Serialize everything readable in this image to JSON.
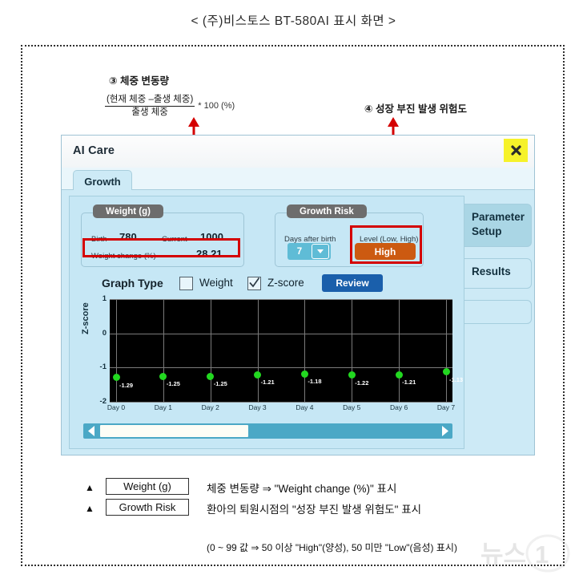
{
  "figure_caption": "< (주)비스토스 BT-580AI 표시 화면 >",
  "annotations": [
    {
      "id": "annotation-weight-change",
      "title": "③ 체중 변동량",
      "formula_numerator": "(현재 체중 –출생 체중)",
      "formula_denominator": "출생 체중",
      "formula_tail": "* 100 (%)"
    },
    {
      "id": "annotation-growth-risk",
      "title": "④ 성장 부진 발생 위험도"
    }
  ],
  "app": {
    "title": "AI Care",
    "close_icon": "close-x-icon",
    "tabs": [
      {
        "label": "Growth",
        "selected": true
      }
    ],
    "side_tabs": [
      {
        "label": "Parameter Setup",
        "selected": true
      },
      {
        "label": "Results",
        "selected": false
      }
    ],
    "weight_group": {
      "legend": "Weight (g)",
      "birth_label": "Birth",
      "birth_value": "780",
      "current_label": "Current",
      "current_value": "1000",
      "change_label": "Weight change (%)",
      "change_value": "28.21"
    },
    "risk_group": {
      "legend": "Growth Risk",
      "days_label": "Days after birth",
      "days_value": "7",
      "dropdown_icon": "chevron-down-icon",
      "level_label": "Level (Low, High)",
      "level_value": "High"
    },
    "graph_type": {
      "label": "Graph Type",
      "options": [
        {
          "label": "Weight",
          "checked": false
        },
        {
          "label": "Z-score",
          "checked": true
        }
      ],
      "review_label": "Review"
    },
    "scrollbar": {
      "left_icon": "triangle-left-icon",
      "right_icon": "triangle-right-icon"
    }
  },
  "chart_data": {
    "type": "scatter",
    "title": "",
    "xlabel": "",
    "ylabel": "Z-score",
    "categories": [
      "Day 0",
      "Day 1",
      "Day 2",
      "Day 3",
      "Day 4",
      "Day 5",
      "Day 6",
      "Day 7"
    ],
    "values": [
      -1.29,
      -1.25,
      -1.25,
      -1.21,
      -1.18,
      -1.22,
      -1.21,
      -1.13
    ],
    "point_labels": [
      "-1.29",
      "-1.25",
      "-1.25",
      "-1.21",
      "-1.18",
      "-1.22",
      "-1.21",
      "-1.13"
    ],
    "yticks": [
      1,
      0,
      -1,
      -2
    ],
    "ytick_labels": [
      "1",
      "0",
      "-1",
      "-2"
    ],
    "ylim": [
      -2,
      1
    ],
    "grid": true,
    "legend": "none",
    "series_color": "#22d820",
    "plot_background": "#000000"
  },
  "legend_notes": [
    {
      "marker": "▲",
      "box": "Weight (g)",
      "text": "체중 변동량 ⇒ \"Weight change (%)\" 표시"
    },
    {
      "marker": "▲",
      "box": "Growth Risk",
      "text": "환아의 퇴원시점의 \"성장 부진 발생 위험도\" 표시",
      "sub": "(0 ~ 99 값 ⇒ 50 이상 \"High\"(양성), 50 미만 \"Low\"(음성) 표시)"
    }
  ],
  "watermark": "뉴스1",
  "colors": {
    "accent_red": "#d40000",
    "app_bg": "#cdeaf6",
    "risk_high": "#cc5a11",
    "review_blue": "#1a5fab",
    "close_yellow": "#f6f22a",
    "point_green": "#22d820"
  }
}
